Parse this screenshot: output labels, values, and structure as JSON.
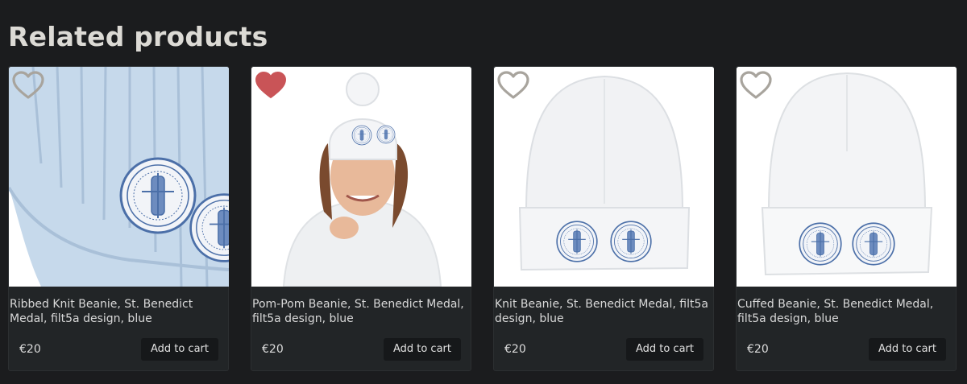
{
  "section_title": "Related products",
  "colors": {
    "background": "#1b1c1e",
    "card": "#222527",
    "heart_active": "#c95457",
    "heart_inactive": "#a8a49d",
    "medal_blue": "#4b6fa8"
  },
  "products": [
    {
      "title": "Ribbed Knit Beanie, St. Benedict Medal, filt5a design, blue",
      "price": "€20",
      "add_to_cart": "Add to cart",
      "favorited": false,
      "image": "light-blue-ribbed-beanie-closeup"
    },
    {
      "title": "Pom-Pom Beanie, St. Benedict Medal, filt5a design, blue",
      "price": "€20",
      "add_to_cart": "Add to cart",
      "favorited": true,
      "image": "woman-wearing-white-pom-pom-beanie"
    },
    {
      "title": "Knit Beanie, St. Benedict Medal, filt5a design, blue",
      "price": "€20",
      "add_to_cart": "Add to cart",
      "favorited": false,
      "image": "white-knit-beanie"
    },
    {
      "title": "Cuffed Beanie, St. Benedict Medal, filt5a design, blue",
      "price": "€20",
      "add_to_cart": "Add to cart",
      "favorited": false,
      "image": "white-cuffed-beanie"
    }
  ]
}
